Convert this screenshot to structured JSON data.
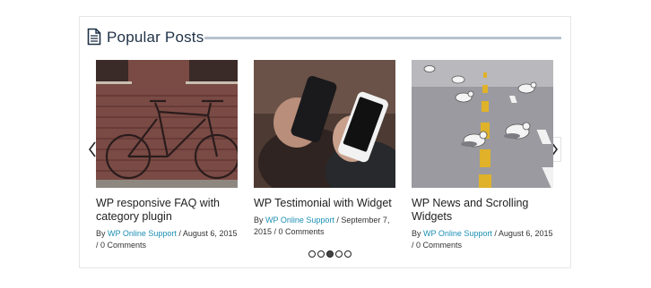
{
  "widget": {
    "title": "Popular Posts",
    "icon": "document-icon"
  },
  "posts": [
    {
      "title": "WP responsive FAQ with category plugin",
      "by": "By",
      "author": "WP Online Support",
      "meta_rest": " / August 6, 2015 / 0 Comments",
      "image": "bicycle-photo"
    },
    {
      "title": "WP Testimonial with Widget",
      "by": "By",
      "author": "WP Online Support",
      "meta_rest": " / September 7, 2015 / 0 Comments",
      "image": "smartphones-photo"
    },
    {
      "title": "WP News and Scrolling Widgets",
      "by": "By",
      "author": "WP Online Support",
      "meta_rest": " / August 6, 2015 / 0 Comments",
      "image": "seagulls-road-photo"
    }
  ],
  "slider": {
    "page_count": 5,
    "active_page": 3,
    "prev_icon": "chevron-left-icon",
    "next_icon": "chevron-right-icon"
  },
  "colors": {
    "title": "#1f3147",
    "rule": "#b7c2cd",
    "link": "#1b8fb3"
  }
}
